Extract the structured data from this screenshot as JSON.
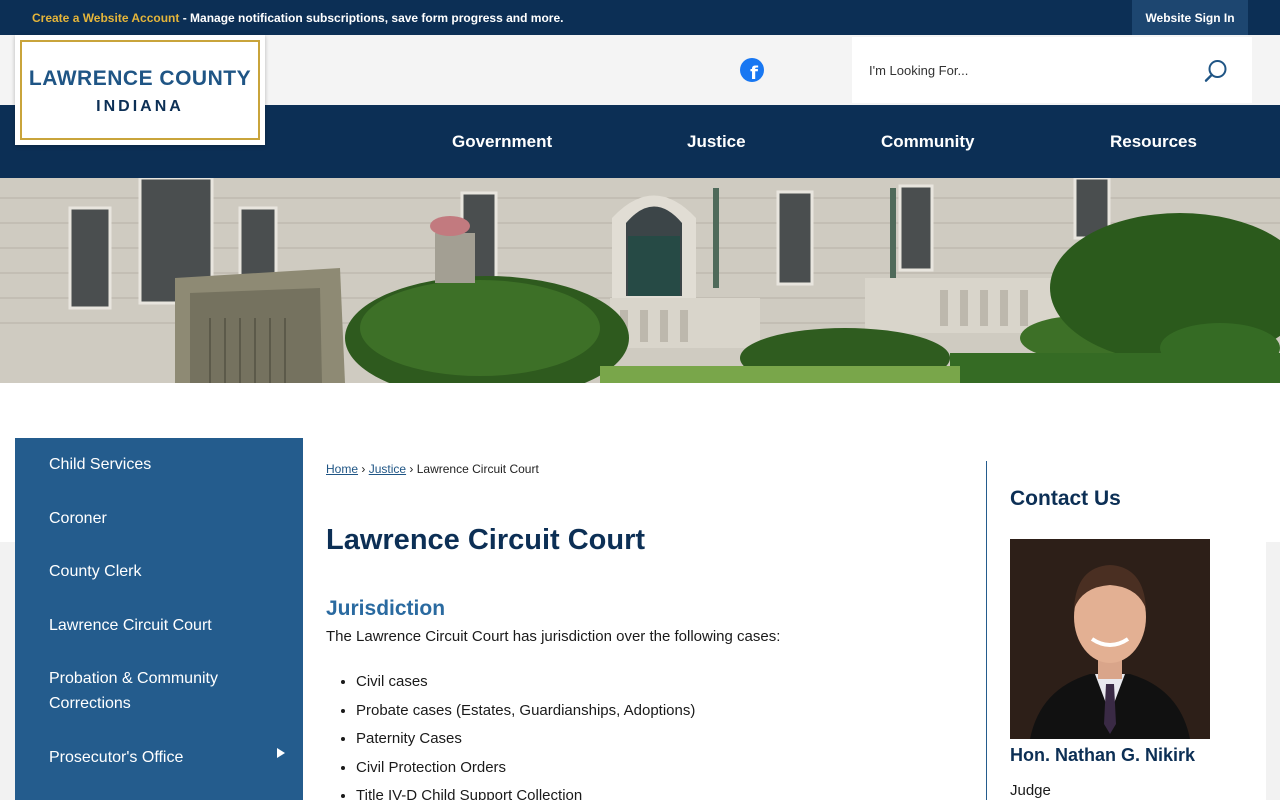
{
  "topbar": {
    "create_account_link": "Create a Website Account",
    "message": " - Manage notification subscriptions, save form progress and more.",
    "sign_in": "Website Sign In"
  },
  "logo": {
    "line1": "LAWRENCE COUNTY",
    "line2": "INDIANA"
  },
  "header": {
    "facebook_icon": "facebook-icon",
    "search_placeholder": "I'm Looking For...",
    "search_icon": "search-icon"
  },
  "nav": {
    "items": [
      "Government",
      "Justice",
      "Community",
      "Resources"
    ]
  },
  "sidebar": {
    "items": [
      "Child Services",
      "Coroner",
      "County Clerk",
      "Lawrence Circuit Court",
      "Probation & Community Corrections",
      "Prosecutor's Office"
    ]
  },
  "breadcrumb": {
    "home": "Home",
    "justice": "Justice",
    "separator": "›",
    "current": "Lawrence Circuit Court"
  },
  "main": {
    "title": "Lawrence Circuit Court",
    "section_heading": "Jurisdiction",
    "intro": "The Lawrence Circuit Court has jurisdiction over the following cases:",
    "cases": [
      "Civil cases",
      "Probate cases (Estates, Guardianships, Adoptions)",
      "Paternity Cases",
      "Civil Protection Orders",
      "Title IV-D Child Support Collection"
    ]
  },
  "contact": {
    "heading": "Contact Us",
    "name": "Hon. Nathan G. Nikirk",
    "role": "Judge"
  },
  "colors": {
    "navy": "#0c2f55",
    "sidebar_blue": "#245c8d",
    "gold": "#c9a43b",
    "heading_blue": "#2a6aa0"
  }
}
